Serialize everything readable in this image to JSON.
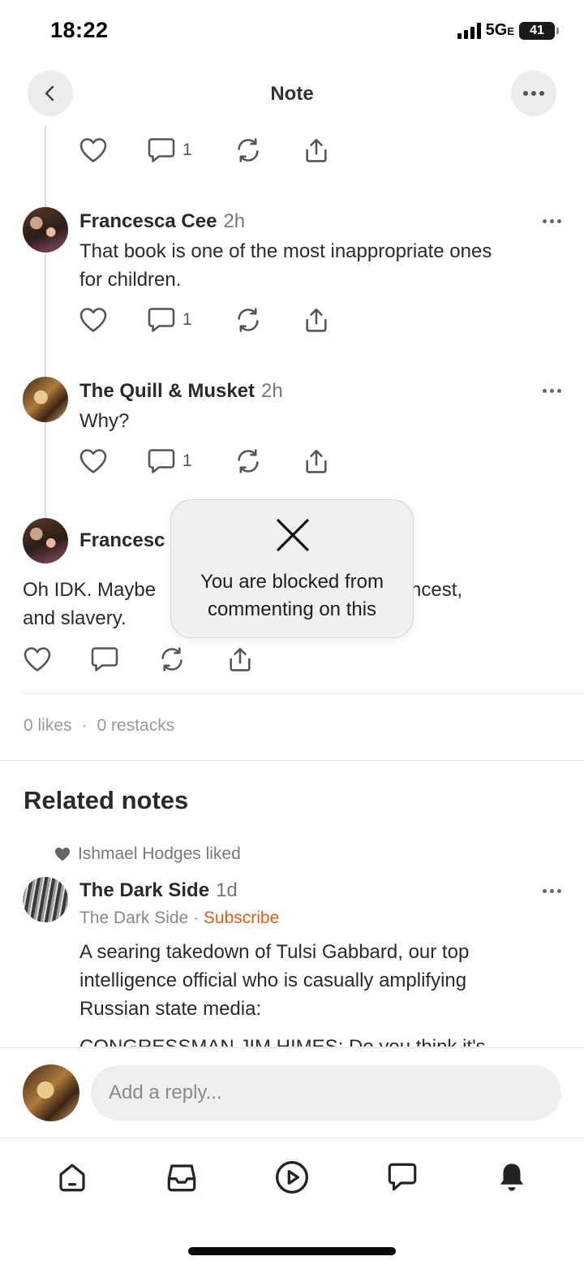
{
  "status_bar": {
    "time": "18:22",
    "network": "5G",
    "network_suffix": "E",
    "battery": "41"
  },
  "header": {
    "title": "Note"
  },
  "top_actions": {
    "comment_count": "1"
  },
  "comments": [
    {
      "author": "Francesca Cee",
      "time": "2h",
      "text_line1": "That book is one of the most inappropriate ones",
      "text_line2": "for children.",
      "comment_count": "1"
    },
    {
      "author": "The Quill & Musket",
      "time": "2h",
      "text": "Why?",
      "comment_count": "1"
    }
  ],
  "main_note": {
    "author": "Francesc",
    "text_line1_start": "Oh IDK. Maybe",
    "text_line1_end": "ncest,",
    "text_line2": "and slavery."
  },
  "stats": {
    "likes": "0 likes",
    "separator": "·",
    "restacks": "0 restacks"
  },
  "toast": {
    "line1": "You are blocked from",
    "line2": "commenting on this"
  },
  "related": {
    "title": "Related notes",
    "liked_by": "Ishmael Hodges liked",
    "author": "The Dark Side",
    "time": "1d",
    "publication": "The Dark Side",
    "dot": " · ",
    "subscribe": "Subscribe",
    "text_line1": "A searing takedown of Tulsi Gabbard, our top",
    "text_line2": "intelligence official who is casually amplifying",
    "text_line3": "Russian state media:",
    "text_line4": "CONGRESSMAN JIM HIMES: Do you think it's"
  },
  "reply": {
    "placeholder": "Add a reply..."
  },
  "tabs": [
    "home-icon",
    "inbox-icon",
    "play-icon",
    "chat-icon",
    "bell-icon"
  ],
  "colors": {
    "accent": "#e85b14",
    "text": "#2a2a2a",
    "muted": "#777777"
  }
}
